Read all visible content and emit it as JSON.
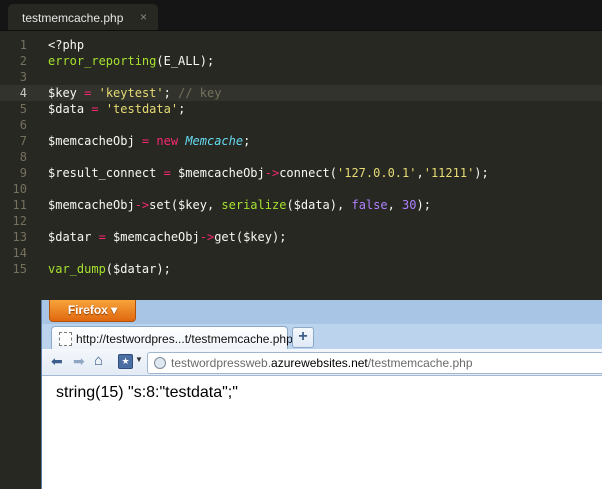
{
  "editor": {
    "tab": {
      "title": "testmemcache.php",
      "close": "×"
    },
    "lines": [
      {
        "n": "1",
        "tokens": [
          [
            "var",
            "<?php"
          ]
        ]
      },
      {
        "n": "2",
        "tokens": [
          [
            "fn",
            "error_reporting"
          ],
          [
            "var",
            "(E_ALL);"
          ]
        ]
      },
      {
        "n": "3",
        "tokens": []
      },
      {
        "n": "4",
        "active": true,
        "tokens": [
          [
            "var",
            "$key "
          ],
          [
            "op",
            "="
          ],
          [
            "var",
            " "
          ],
          [
            "str",
            "'keytest'"
          ],
          [
            "var",
            "; "
          ],
          [
            "cmt",
            "// key"
          ]
        ]
      },
      {
        "n": "5",
        "tokens": [
          [
            "var",
            "$data "
          ],
          [
            "op",
            "="
          ],
          [
            "var",
            " "
          ],
          [
            "str",
            "'testdata'"
          ],
          [
            "var",
            ";"
          ]
        ]
      },
      {
        "n": "6",
        "tokens": []
      },
      {
        "n": "7",
        "tokens": [
          [
            "var",
            "$memcacheObj "
          ],
          [
            "op",
            "="
          ],
          [
            "var",
            " "
          ],
          [
            "kw",
            "new"
          ],
          [
            "var",
            " "
          ],
          [
            "cls",
            "Memcache"
          ],
          [
            "var",
            ";"
          ]
        ]
      },
      {
        "n": "8",
        "tokens": []
      },
      {
        "n": "9",
        "tokens": [
          [
            "var",
            "$result_connect "
          ],
          [
            "op",
            "="
          ],
          [
            "var",
            " $memcacheObj"
          ],
          [
            "op",
            "->"
          ],
          [
            "var",
            "connect("
          ],
          [
            "str",
            "'127.0.0.1'"
          ],
          [
            "var",
            ","
          ],
          [
            "str",
            "'11211'"
          ],
          [
            "var",
            ");"
          ]
        ]
      },
      {
        "n": "10",
        "tokens": []
      },
      {
        "n": "11",
        "tokens": [
          [
            "var",
            "$memcacheObj"
          ],
          [
            "op",
            "->"
          ],
          [
            "var",
            "set($key, "
          ],
          [
            "fn",
            "serialize"
          ],
          [
            "var",
            "($data), "
          ],
          [
            "num",
            "false"
          ],
          [
            "var",
            ", "
          ],
          [
            "num",
            "30"
          ],
          [
            "var",
            ");"
          ]
        ]
      },
      {
        "n": "12",
        "tokens": []
      },
      {
        "n": "13",
        "tokens": [
          [
            "var",
            "$datar "
          ],
          [
            "op",
            "="
          ],
          [
            "var",
            " $memcacheObj"
          ],
          [
            "op",
            "->"
          ],
          [
            "var",
            "get($key);"
          ]
        ]
      },
      {
        "n": "14",
        "tokens": []
      },
      {
        "n": "15",
        "tokens": [
          [
            "fn",
            "var_dump"
          ],
          [
            "var",
            "($datar);"
          ]
        ]
      }
    ]
  },
  "browser": {
    "menu_label": "Firefox ▾",
    "tab_title": "http://testwordpres...t/testmemcache.php",
    "new_tab": "+",
    "nav": {
      "back": "⬅",
      "forward": "➡",
      "home": "⌂",
      "bookmark": "★",
      "bookmark_arrow": "▼"
    },
    "url": {
      "prefix": "testwordpressweb.",
      "domain": "azurewebsites.net",
      "path": "/testmemcache.php"
    },
    "content": "string(15) \"s:8:\"testdata\";\""
  },
  "colors": {
    "editor_bg": "#272822",
    "keyword": "#f92672",
    "function": "#a6e22e",
    "string": "#e6db74",
    "number": "#ae81ff",
    "class": "#66d9ef",
    "comment": "#75715e",
    "firefox_orange": "#e0680f"
  },
  "icons": [
    "close-icon",
    "page-favicon-icon",
    "back-arrow-icon",
    "forward-arrow-icon",
    "home-icon",
    "bookmark-icon",
    "globe-icon"
  ]
}
